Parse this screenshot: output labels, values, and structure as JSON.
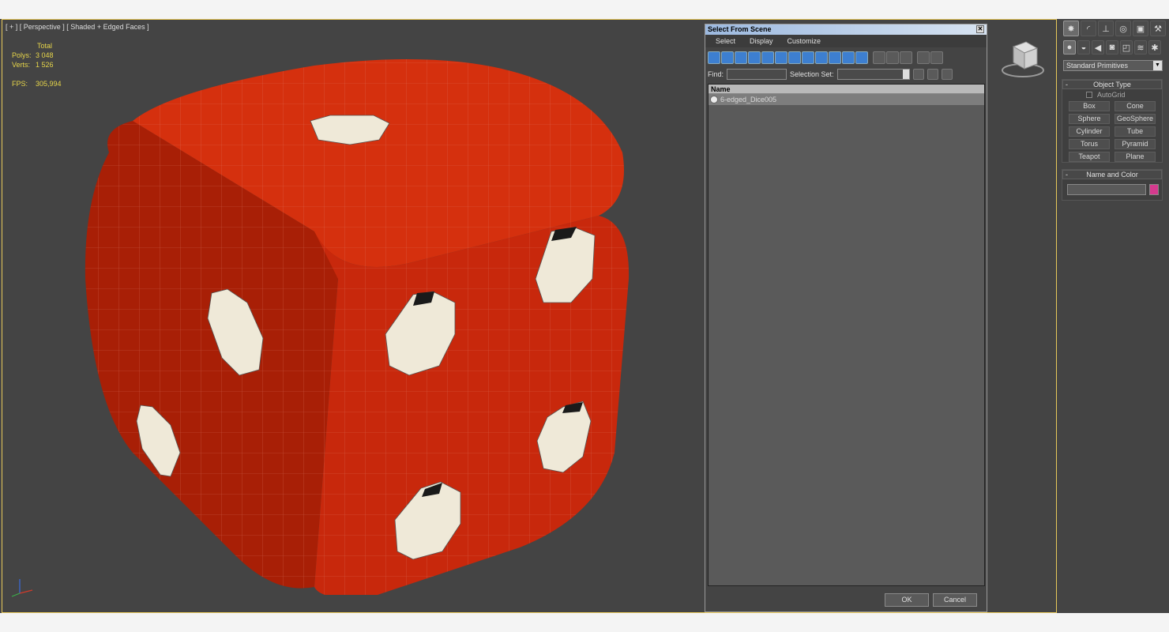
{
  "viewport": {
    "label": "[ + ] [ Perspective ] [ Shaded + Edged Faces ]",
    "stats": {
      "header": "Total",
      "polys_label": "Polys:",
      "polys_value": "3 048",
      "verts_label": "Verts:",
      "verts_value": "1 526",
      "fps_label": "FPS:",
      "fps_value": "305,994"
    },
    "object_color": "#c92a0d",
    "pip_color": "#efe9d8"
  },
  "dialog": {
    "title": "Select From Scene",
    "close_glyph": "✕",
    "menu": [
      "Select",
      "Display",
      "Customize"
    ],
    "find_label": "Find:",
    "selection_set_label": "Selection Set:",
    "list_header": "Name",
    "items": [
      {
        "name": "6-edged_Dice005"
      }
    ],
    "ok_label": "OK",
    "cancel_label": "Cancel"
  },
  "command_panel": {
    "dropdown": "Standard Primitives",
    "object_type_title": "Object Type",
    "autogrid_label": "AutoGrid",
    "primitives": [
      "Box",
      "Cone",
      "Sphere",
      "GeoSphere",
      "Cylinder",
      "Tube",
      "Torus",
      "Pyramid",
      "Teapot",
      "Plane"
    ],
    "name_color_title": "Name and Color",
    "swatch_color": "#d43a8e"
  }
}
